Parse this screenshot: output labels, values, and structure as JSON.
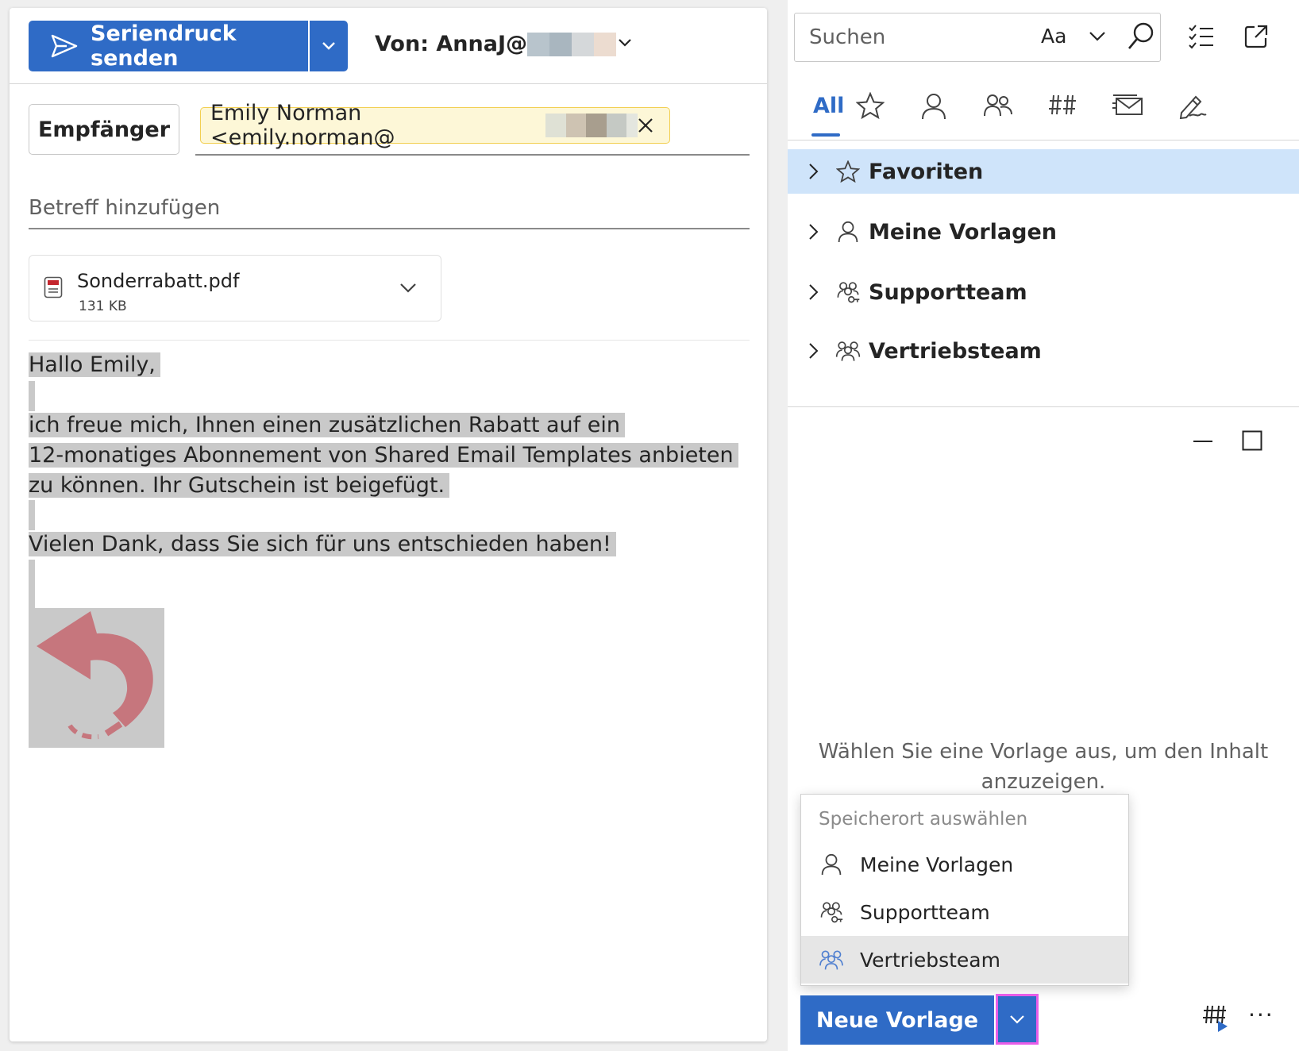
{
  "compose": {
    "send_label": "Seriendruck senden",
    "from_label": "Von: AnnaJ@",
    "to_button": "Empfänger",
    "recipient": "Emily Norman <emily.norman@",
    "subject_placeholder": "Betreff hinzufügen",
    "attachment": {
      "name": "Sonderrabatt.pdf",
      "size": "131 KB"
    },
    "body": {
      "greeting": "Hallo Emily,",
      "paragraph_lines": [
        "ich freue mich, Ihnen einen zusätzlichen Rabatt auf ein",
        "12-monatiges Abonnement von Shared Email Templates anbieten",
        "zu können. Ihr Gutschein ist beigefügt."
      ],
      "closing": "Vielen Dank, dass Sie sich für uns entschieden haben!"
    }
  },
  "templates": {
    "search_placeholder": "Suchen",
    "match_case_label": "Aa",
    "tabs": [
      {
        "label": "All",
        "icon": "all",
        "active": true
      },
      {
        "label": "",
        "icon": "star-icon"
      },
      {
        "label": "",
        "icon": "person-icon"
      },
      {
        "label": "",
        "icon": "people-icon"
      },
      {
        "label": "",
        "icon": "hash-icon"
      },
      {
        "label": "",
        "icon": "mail-stack-icon"
      },
      {
        "label": "",
        "icon": "signature-icon"
      }
    ],
    "tree": [
      {
        "label": "Favoriten",
        "icon": "star-icon",
        "selected": true
      },
      {
        "label": "Meine Vorlagen",
        "icon": "person-icon"
      },
      {
        "label": "Supportteam",
        "icon": "people-key-icon"
      },
      {
        "label": "Vertriebsteam",
        "icon": "people-icon"
      }
    ],
    "empty_message": "Wählen Sie eine Vorlage aus, um den Inhalt anzuzeigen.",
    "location_menu": {
      "header": "Speicherort auswählen",
      "items": [
        {
          "label": "Meine Vorlagen",
          "icon": "person-icon"
        },
        {
          "label": "Supportteam",
          "icon": "people-key-icon"
        },
        {
          "label": "Vertriebsteam",
          "icon": "people-icon",
          "hovered": true
        }
      ]
    },
    "new_template_label": "Neue Vorlage",
    "more_label": "···"
  },
  "colors": {
    "accent": "#2f6bc6",
    "selection": "#cfe4fa",
    "chip_bg": "#fdf7d7",
    "chip_border": "#f2cf51",
    "highlight": "#c9c9c9",
    "focus_ring": "#e85de8"
  }
}
